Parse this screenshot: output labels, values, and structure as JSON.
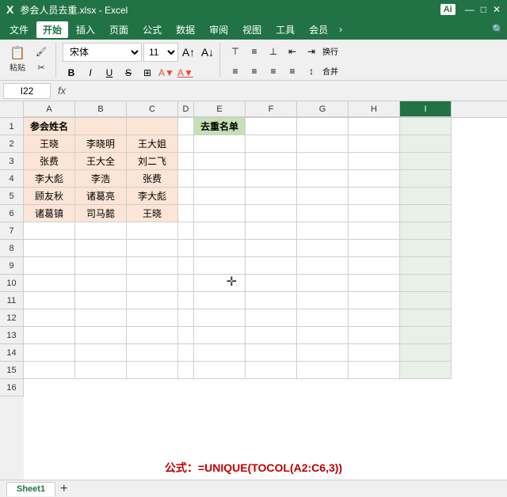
{
  "titlebar": {
    "filename": "参会人员去重.xlsx - Excel",
    "ai_label": "Ai",
    "window_controls": [
      "—",
      "□",
      "✕"
    ]
  },
  "menubar": {
    "items": [
      "文件",
      "开始",
      "插入",
      "页面",
      "公式",
      "数据",
      "审阅",
      "视图",
      "工具",
      "会员"
    ],
    "active": "开始"
  },
  "toolbar": {
    "paste_label": "粘贴",
    "format_label": "格式刷",
    "cut_label": "剪切",
    "font_name": "宋体",
    "font_size": "11",
    "bold": "B",
    "italic": "I",
    "underline": "U",
    "strikethrough": "S",
    "wrap_label": "换行",
    "merge_label": "合并",
    "align_left": "≡",
    "align_center": "≡",
    "align_right": "≡"
  },
  "formula_bar": {
    "cell_ref": "I22",
    "formula_icon": "f",
    "formula_value": ""
  },
  "columns": [
    "A",
    "B",
    "C",
    "D",
    "E",
    "F",
    "G",
    "H",
    "I"
  ],
  "rows": [
    {
      "num": "1",
      "cells": [
        "参会姓名",
        "",
        "",
        "",
        "去重名单",
        "",
        "",
        "",
        ""
      ]
    },
    {
      "num": "2",
      "cells": [
        "王晓",
        "李晓明",
        "王大姐",
        "",
        "",
        "",
        "",
        "",
        ""
      ]
    },
    {
      "num": "3",
      "cells": [
        "张费",
        "王大全",
        "刘二飞",
        "",
        "",
        "",
        "",
        "",
        ""
      ]
    },
    {
      "num": "4",
      "cells": [
        "李大彪",
        "李浩",
        "张费",
        "",
        "",
        "",
        "",
        "",
        ""
      ]
    },
    {
      "num": "5",
      "cells": [
        "顾友秋",
        "诸葛亮",
        "李大彪",
        "",
        "",
        "",
        "",
        "",
        ""
      ]
    },
    {
      "num": "6",
      "cells": [
        "诸葛镇",
        "司马懿",
        "王晓",
        "",
        "",
        "",
        "",
        "",
        ""
      ]
    },
    {
      "num": "7",
      "cells": [
        "",
        "",
        "",
        "",
        "",
        "",
        "",
        "",
        ""
      ]
    },
    {
      "num": "8",
      "cells": [
        "",
        "",
        "",
        "",
        "",
        "",
        "",
        "",
        ""
      ]
    },
    {
      "num": "9",
      "cells": [
        "",
        "",
        "",
        "",
        "",
        "",
        "",
        "",
        ""
      ]
    },
    {
      "num": "10",
      "cells": [
        "",
        "",
        "",
        "",
        "",
        "",
        "",
        "",
        ""
      ]
    },
    {
      "num": "11",
      "cells": [
        "",
        "",
        "",
        "",
        "",
        "",
        "",
        "",
        ""
      ]
    },
    {
      "num": "12",
      "cells": [
        "",
        "",
        "",
        "",
        "",
        "",
        "",
        "",
        ""
      ]
    },
    {
      "num": "13",
      "cells": [
        "",
        "",
        "",
        "",
        "",
        "",
        "",
        "",
        ""
      ]
    },
    {
      "num": "14",
      "cells": [
        "",
        "",
        "",
        "",
        "",
        "",
        "",
        "",
        ""
      ]
    },
    {
      "num": "15",
      "cells": [
        "",
        "",
        "",
        "",
        "",
        "",
        "",
        "",
        ""
      ]
    },
    {
      "num": "16",
      "cells": [
        "",
        "",
        "",
        "",
        "",
        "",
        "",
        "",
        ""
      ]
    }
  ],
  "formula_display": "公式：=UNIQUE(TOCOL(A2:C6,3))",
  "sheet_tab": "Sheet1"
}
